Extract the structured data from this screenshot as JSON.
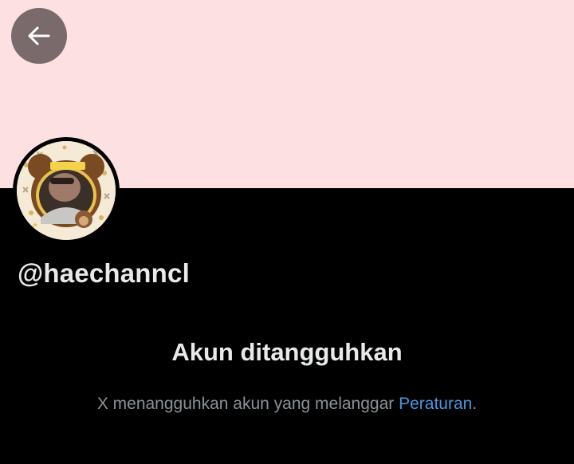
{
  "banner": {
    "color": "#fde0e2"
  },
  "back_button": {
    "icon": "arrow-left-icon"
  },
  "profile": {
    "avatar_icon": "avatar",
    "handle": "@haechanncl"
  },
  "suspension": {
    "title": "Akun ditangguhkan",
    "description_text": "X menangguhkan akun yang melanggar ",
    "rules_link": "Peraturan",
    "period": ".",
    "link_color": "#4a97e0"
  }
}
